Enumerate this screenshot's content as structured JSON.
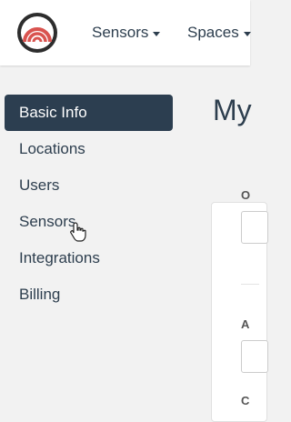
{
  "header": {
    "nav": [
      {
        "label": "Sensors"
      },
      {
        "label": "Spaces"
      }
    ],
    "logo_icon": "concentric-arcs-logo"
  },
  "sidebar": {
    "items": [
      {
        "label": "Basic Info",
        "active": true
      },
      {
        "label": "Locations"
      },
      {
        "label": "Users"
      },
      {
        "label": "Sensors"
      },
      {
        "label": "Integrations"
      },
      {
        "label": "Billing"
      }
    ]
  },
  "main": {
    "title": "My",
    "fields": [
      {
        "label": "O"
      },
      {
        "label": "A"
      },
      {
        "label": "C"
      }
    ]
  },
  "colors": {
    "accent_dark": "#2c3e50",
    "logo_red": "#d9534f",
    "background": "#f2f2f2"
  }
}
